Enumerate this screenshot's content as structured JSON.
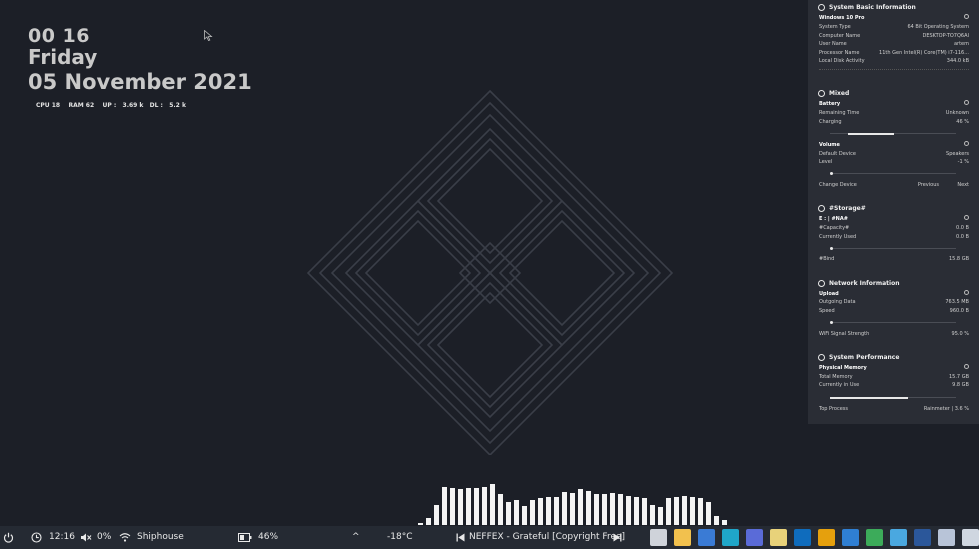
{
  "clock": {
    "time": "00 16",
    "day": "Friday",
    "date": "05 November 2021"
  },
  "stats_line": "CPU 18    RAM 62    UP :   3.69 k   DL :   5.2 k",
  "panel": {
    "system_basic": {
      "title": "System Basic Information",
      "os": "Windows 10 Pro",
      "rows": [
        {
          "k": "System Type",
          "v": "64 Bit Operating System"
        },
        {
          "k": "Computer Name",
          "v": "DESKTOP-TO7Q6AI"
        },
        {
          "k": "User Name",
          "v": "artem"
        },
        {
          "k": "Processor Name",
          "v": "11th Gen Intel(R) Core(TM) i7-116..."
        },
        {
          "k": "Local Disk Activity",
          "v": "344.0 kB"
        }
      ]
    },
    "mixed": {
      "title": "Mixed",
      "battery_label": "Battery",
      "battery_rows": [
        {
          "k": "Remaining Time",
          "v": "Unknown"
        },
        {
          "k": "Charging",
          "v": "46 %"
        }
      ],
      "battery_level": 0.46,
      "volume_label": "Volume",
      "volume_rows": [
        {
          "k": "Default Device",
          "v": "Speakers"
        },
        {
          "k": "Level",
          "v": "-1 %"
        }
      ],
      "change_device": "Change Device",
      "previous": "Previous",
      "next": "Next"
    },
    "storage": {
      "title": "#Storage#",
      "drive": "E :  |  #NA#",
      "rows": [
        {
          "k": "#Capacity#",
          "v": "0.0 B"
        },
        {
          "k": "Currently Used",
          "v": "0.0 B"
        }
      ],
      "free_label": "#Bind",
      "free_value": "15.8 GB"
    },
    "network": {
      "title": "Network Information",
      "upload_label": "Upload",
      "rows": [
        {
          "k": "Outgoing Data",
          "v": "763.5 MB"
        },
        {
          "k": "Speed",
          "v": "960.0 B"
        }
      ],
      "wifi_label": "WiFi Signal Strength",
      "wifi_value": "95.0 %"
    },
    "performance": {
      "title": "System Performance",
      "memory_label": "Physical Memory",
      "rows": [
        {
          "k": "Total Memory",
          "v": "15.7 GB"
        },
        {
          "k": "Currently in Use",
          "v": "9.8 GB"
        }
      ],
      "memory_level": 0.62,
      "top_process_label": "Top Process",
      "top_process_value": "Rainmeter  |  3.6 %"
    }
  },
  "taskbar": {
    "clock": "12:16",
    "mute_value": "0%",
    "network_name": "Shiphouse",
    "battery": "46%",
    "caret": "^",
    "temperature": "-18°C",
    "media_track": "NEFFEX - Grateful [Copyright Free]",
    "pinned_apps": [
      {
        "name": "snipping-tool-icon",
        "color": "#cfd3da"
      },
      {
        "name": "file-explorer-icon",
        "color": "#f2c14e"
      },
      {
        "name": "tablet-app-icon",
        "color": "#3a7bd5"
      },
      {
        "name": "edge-icon",
        "color": "#1fa6c9"
      },
      {
        "name": "store-icon",
        "color": "#5a6bd8"
      },
      {
        "name": "notes-icon",
        "color": "#e8d27a"
      },
      {
        "name": "outlook-icon",
        "color": "#0f6cbd"
      },
      {
        "name": "plex-icon",
        "color": "#e5a00d"
      },
      {
        "name": "mail-icon",
        "color": "#2f7fd3"
      },
      {
        "name": "hub-icon",
        "color": "#3cab5a"
      },
      {
        "name": "snowflake-icon",
        "color": "#4aa8e0"
      },
      {
        "name": "word-icon",
        "color": "#2b579a"
      },
      {
        "name": "ghost-icon",
        "color": "#b8c4d8"
      },
      {
        "name": "grid-icon",
        "color": "#cfd6e0"
      }
    ]
  },
  "visualizer_levels": [
    0.05,
    0.15,
    0.45,
    0.85,
    0.82,
    0.8,
    0.82,
    0.82,
    0.85,
    0.9,
    0.7,
    0.5,
    0.55,
    0.42,
    0.55,
    0.6,
    0.62,
    0.62,
    0.74,
    0.72,
    0.8,
    0.76,
    0.7,
    0.68,
    0.72,
    0.7,
    0.65,
    0.62,
    0.6,
    0.45,
    0.4,
    0.6,
    0.62,
    0.65,
    0.62,
    0.6,
    0.5,
    0.2,
    0.1
  ]
}
